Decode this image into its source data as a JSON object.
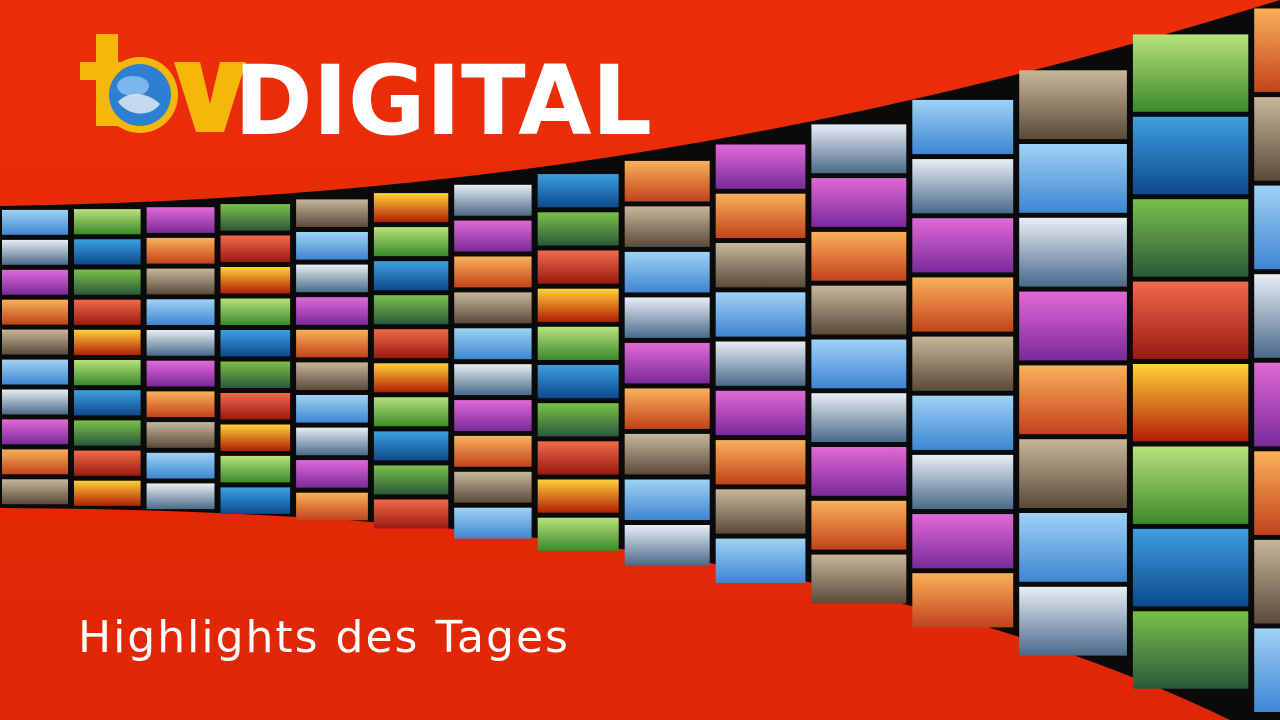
{
  "brand": {
    "logo_tv": "tv",
    "logo_word": "DIGITAL",
    "colors": {
      "background": "#e62a08",
      "logo_accent": "#f5b70a",
      "text": "#ffffff",
      "frame": "#0a0a0a"
    }
  },
  "headline": "Highlights des Tages",
  "video_wall": {
    "tile_themes": [
      "sky",
      "sea",
      "city",
      "grass",
      "sunset",
      "fire",
      "flowers",
      "food",
      "tech",
      "train"
    ],
    "palette": {
      "sky": [
        "#9fd2f5",
        "#3d86d1"
      ],
      "sea": [
        "#3ca0e0",
        "#0c4a8c"
      ],
      "city": [
        "#c8b69a",
        "#5b4a3a"
      ],
      "grass": [
        "#b8e27a",
        "#3a8a2a"
      ],
      "sunset": [
        "#f9b15a",
        "#c2431b"
      ],
      "fire": [
        "#ffd23a",
        "#b31d05"
      ],
      "flowers": [
        "#e06ad6",
        "#7a2a9a"
      ],
      "food": [
        "#f06a4a",
        "#9a1a10"
      ],
      "tech": [
        "#e8eef4",
        "#4a6a8a"
      ],
      "train": [
        "#7ac04a",
        "#2a5a3a"
      ]
    }
  }
}
